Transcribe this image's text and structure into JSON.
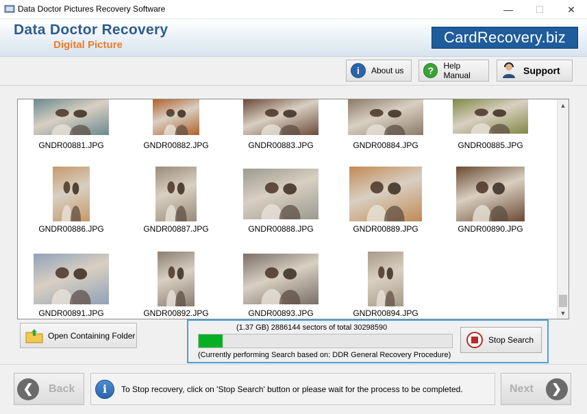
{
  "window": {
    "title": "Data Doctor Pictures Recovery Software",
    "controls": {
      "minimize": "—",
      "maximize": "☐",
      "close": "✕"
    }
  },
  "banner": {
    "brand_line1": "Data Doctor Recovery",
    "brand_line2": "Digital Picture",
    "site": "CardRecovery.biz"
  },
  "toolbar": {
    "about_label": "About us",
    "help_label": "Help Manual",
    "support_label": "Support"
  },
  "gallery": {
    "files": [
      {
        "name": "GNDR00881.JPG",
        "color": "#6b8a8f"
      },
      {
        "name": "GNDR00882.JPG",
        "color": "#b0602a"
      },
      {
        "name": "GNDR00883.JPG",
        "color": "#6a4a3a"
      },
      {
        "name": "GNDR00884.JPG",
        "color": "#8a7a6a"
      },
      {
        "name": "GNDR00885.JPG",
        "color": "#7f8a44"
      },
      {
        "name": "GNDR00886.JPG",
        "color": "#c59a6a"
      },
      {
        "name": "GNDR00887.JPG",
        "color": "#9a8b7a"
      },
      {
        "name": "GNDR00888.JPG",
        "color": "#9a9a8e"
      },
      {
        "name": "GNDR00889.JPG",
        "color": "#c08a55"
      },
      {
        "name": "GNDR00890.JPG",
        "color": "#6a4a32"
      },
      {
        "name": "GNDR00891.JPG",
        "color": "#8fa2b8"
      },
      {
        "name": "GNDR00892.JPG",
        "color": "#8a7e72"
      },
      {
        "name": "GNDR00893.JPG",
        "color": "#7a6e66"
      },
      {
        "name": "GNDR00894.JPG",
        "color": "#a89a88"
      }
    ]
  },
  "actions": {
    "open_folder_label": "Open Containing Folder",
    "stop_search_label": "Stop Search"
  },
  "progress": {
    "sectors_text": "(1.37 GB) 2886144  sectors  of  total 30298590",
    "fraction": 0.095,
    "status_text": "(Currently performing Search based on:  DDR General Recovery Procedure)"
  },
  "footer": {
    "back_label": "Back",
    "next_label": "Next",
    "info_text": "To Stop recovery, click on 'Stop Search' button or please wait for the process to be completed."
  },
  "colors": {
    "brand_blue": "#2d5c8e",
    "brand_orange": "#ee7b2a",
    "site_badge": "#1f5c9c",
    "progress_green": "#06b025",
    "panel_highlight": "#4aa1d8",
    "stop_red": "#b82a2a"
  }
}
